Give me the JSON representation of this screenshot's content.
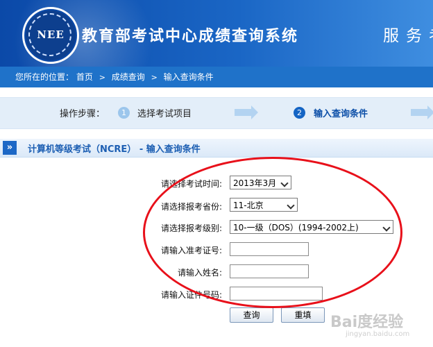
{
  "header": {
    "logo_text": "NEE",
    "site_title": "教育部考试中心成绩查询系统",
    "slogan": "服务考"
  },
  "breadcrumb": {
    "lead": "您所在的位置：",
    "items": [
      "首页",
      "成绩查询",
      "输入查询条件"
    ],
    "separator": ">"
  },
  "steps": {
    "label": "操作步骤：",
    "items": [
      {
        "num": "1",
        "text": "选择考试项目",
        "active": false
      },
      {
        "num": "2",
        "text": "输入查询条件",
        "active": true
      }
    ]
  },
  "section": {
    "chevron": "»",
    "title": "计算机等级考试（NCRE） - 输入查询条件"
  },
  "form": {
    "exam_time_label": "请选择考试时间:",
    "exam_time_value": "2013年3月",
    "province_label": "请选择报考省份:",
    "province_value": "11-北京",
    "level_label": "请选择报考级别:",
    "level_value": "10-一级（DOS）(1994-2002上)",
    "ticket_label": "请输入准考证号:",
    "name_label": "请输入姓名:",
    "id_label": "请输入证件号码:",
    "query_button": "查询",
    "reset_button": "重填"
  },
  "watermark": {
    "text": "Bai度经验",
    "sub": "jingyan.baidu.com"
  },
  "colors": {
    "header_blue": "#1a66c5",
    "crumb_blue": "#1f72c9",
    "annotation_red": "#e8101a"
  }
}
